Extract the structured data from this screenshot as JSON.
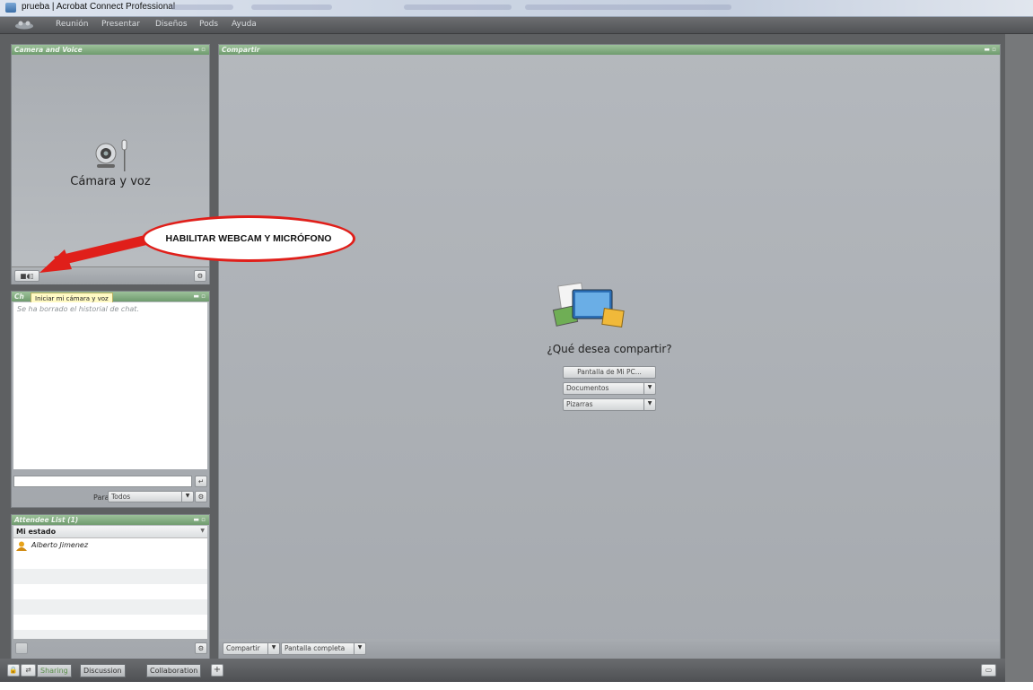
{
  "window": {
    "title": "prueba | Acrobat Connect Professional"
  },
  "menu": {
    "items": [
      "Reunión",
      "Presentar",
      "Diseños",
      "Pods",
      "Ayuda"
    ]
  },
  "camera_pod": {
    "title": "Camera and Voice",
    "center_label": "Cámara y voz",
    "icon": "webcam-mic-icon"
  },
  "chat_pod": {
    "title_visible": "Ch",
    "tooltip": "Iniciar mi cámara y voz",
    "history_message": "Se ha borrado el historial de chat.",
    "input_value": "",
    "to_label": "Para:",
    "to_value": "Todos"
  },
  "attendee_pod": {
    "title": "Attendee List (1)",
    "status_header": "Mi estado",
    "attendees": [
      {
        "name": "Alberto Jimenez",
        "icon": "host-user-icon"
      }
    ]
  },
  "share_pod": {
    "title": "Compartir",
    "prompt": "¿Qué desea compartir?",
    "options": {
      "screen": "Pantalla de Mi PC...",
      "documents": "Documentos",
      "whiteboards": "Pizarras"
    },
    "footer": {
      "share_dropdown": "Compartir",
      "fullscreen_dropdown": "Pantalla completa"
    }
  },
  "layouts_bar": {
    "tabs": [
      "Sharing",
      "Discussion",
      "Collaboration"
    ],
    "add_label": "+"
  },
  "annotation": {
    "text": "HABILITAR WEBCAM Y MICRÓFONO",
    "color": "#e01f1a"
  },
  "colors": {
    "pod_header": "#7fa97e",
    "menubar": "#5c5e61",
    "workspace": "#5e6062",
    "tooltip_bg": "#fffac4"
  }
}
